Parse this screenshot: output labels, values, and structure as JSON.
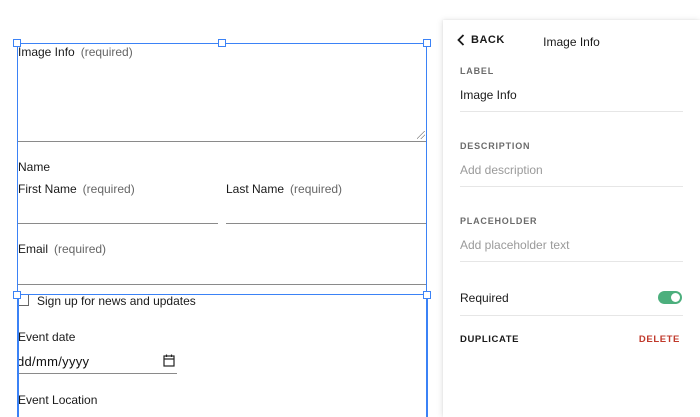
{
  "form": {
    "image_info": {
      "label": "Image Info",
      "required": "(required)"
    },
    "name": {
      "group_label": "Name",
      "first_label": "First Name",
      "first_required": "(required)",
      "last_label": "Last Name",
      "last_required": "(required)"
    },
    "email": {
      "label": "Email",
      "required": "(required)"
    },
    "newsletter": {
      "label": "Sign up for news and updates",
      "checked": false
    },
    "event_date": {
      "label": "Event date",
      "value": "dd/mm/yyyy"
    },
    "event_location": {
      "label": "Event Location"
    }
  },
  "panel": {
    "back_label": "BACK",
    "title": "Image Info",
    "label_section": {
      "heading": "LABEL",
      "value": "Image Info"
    },
    "description_section": {
      "heading": "DESCRIPTION",
      "placeholder": "Add description"
    },
    "placeholder_section": {
      "heading": "PLACEHOLDER",
      "placeholder": "Add placeholder text"
    },
    "required": {
      "label": "Required",
      "enabled": true
    },
    "duplicate_label": "DUPLICATE",
    "delete_label": "DELETE"
  },
  "colors": {
    "selection": "#3b82f6",
    "toggle_on": "#4caf7d",
    "delete": "#c0392b"
  }
}
